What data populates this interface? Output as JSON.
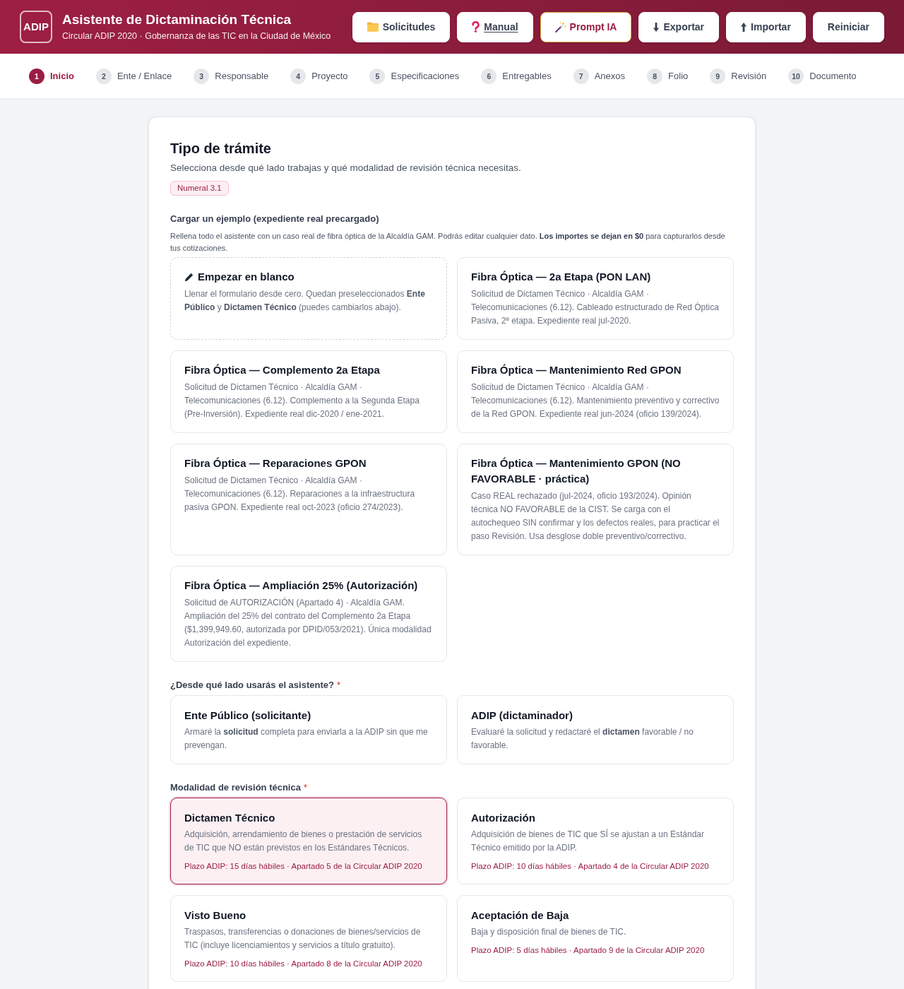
{
  "header": {
    "logo": "ADIP",
    "title": "Asistente de Dictaminación Técnica",
    "subtitle": "Circular ADIP 2020 · Gobernanza de las TIC en la Ciudad de México",
    "buttons": [
      {
        "label": "Solicitudes",
        "kind": "folder"
      },
      {
        "label": "Manual",
        "kind": "help"
      },
      {
        "label": "Prompt IA",
        "kind": "ai"
      },
      {
        "label": "Exportar",
        "kind": "export"
      },
      {
        "label": "Importar",
        "kind": "import"
      },
      {
        "label": "Reiniciar",
        "kind": "plain"
      }
    ]
  },
  "steps": [
    {
      "number": "1",
      "label": "Inicio",
      "selected": true
    },
    {
      "number": "2",
      "label": "Ente / Enlace",
      "selected": false
    },
    {
      "number": "3",
      "label": "Responsable",
      "selected": false
    },
    {
      "number": "4",
      "label": "Proyecto",
      "selected": false
    },
    {
      "number": "5",
      "label": "Especificaciones",
      "selected": false
    },
    {
      "number": "6",
      "label": "Entregables",
      "selected": false
    },
    {
      "number": "7",
      "label": "Anexos",
      "selected": false
    },
    {
      "number": "8",
      "label": "Folio",
      "selected": false
    },
    {
      "number": "9",
      "label": "Revisión",
      "selected": false
    },
    {
      "number": "10",
      "label": "Documento",
      "selected": false
    }
  ],
  "form": {
    "title": "Tipo de trámite",
    "description": "Selecciona desde qué lado trabajas y qué modalidad de revisión técnica necesitas.",
    "badge": "Numeral 3.1",
    "examples": {
      "label": "Cargar un ejemplo (expediente real precargado)",
      "description": "Rellena todo el asistente con un caso real de fibra óptica de la Alcaldía GAM. Podrás editar cualquier dato. **Los importes se dejan en $0** para capturarlos desde tus cotizaciones.",
      "cards": [
        {
          "kind": "blank",
          "title": "Empezar en blanco",
          "description": "Llenar el formulario desde cero. Quedan preseleccionados **Ente Público** y **Dictamen Técnico** (puedes cambiarlos abajo)."
        },
        {
          "kind": "example",
          "title": "Fibra Óptica — 2a Etapa (PON LAN)",
          "description": "Solicitud de Dictamen Técnico · Alcaldía GAM · Telecomunicaciones (6.12). Cableado estructurado de Red Óptica Pasiva, 2ª etapa. Expediente real jul-2020."
        },
        {
          "kind": "example",
          "title": "Fibra Óptica — Complemento 2a Etapa",
          "description": "Solicitud de Dictamen Técnico · Alcaldía GAM · Telecomunicaciones (6.12). Complemento a la Segunda Etapa (Pre-Inversión). Expediente real dic-2020 / ene-2021."
        },
        {
          "kind": "example",
          "title": "Fibra Óptica — Mantenimiento Red GPON",
          "description": "Solicitud de Dictamen Técnico · Alcaldía GAM · Telecomunicaciones (6.12). Mantenimiento preventivo y correctivo de la Red GPON. Expediente real jun-2024 (oficio 139/2024)."
        },
        {
          "kind": "example",
          "title": "Fibra Óptica — Reparaciones GPON",
          "description": "Solicitud de Dictamen Técnico · Alcaldía GAM · Telecomunicaciones (6.12). Reparaciones a la infraestructura pasiva GPON. Expediente real oct-2023 (oficio 274/2023)."
        },
        {
          "kind": "example",
          "title": "Fibra Óptica — Mantenimiento GPON (NO FAVORABLE · práctica)",
          "description": "Caso REAL rechazado (jul-2024, oficio 193/2024). Opinión técnica NO FAVORABLE de la CIST. Se carga con el autochequeo SIN confirmar y los defectos reales, para practicar el paso Revisión. Usa desglose doble preventivo/correctivo."
        },
        {
          "kind": "example",
          "title": "Fibra Óptica — Ampliación 25% (Autorización)",
          "description": "Solicitud de AUTORIZACIÓN (Apartado 4) · Alcaldía GAM. Ampliación del 25% del contrato del Complemento 2a Etapa ($1,399,949.60, autorizada por DPID/053/2021). Única modalidad Autorización del expediente."
        }
      ]
    },
    "sides": {
      "label": "¿Desde qué lado usarás el asistente?",
      "required_mark": "*",
      "options": [
        {
          "title": "Ente Público (solicitante)",
          "description": "Armaré la **solicitud** completa para enviarla a la ADIP sin que me prevengan.",
          "selected": false
        },
        {
          "title": "ADIP (dictaminador)",
          "description": "Evaluaré la solicitud y redactaré el **dictamen** favorable / no favorable.",
          "selected": false
        }
      ]
    },
    "modalities": {
      "label": "Modalidad de revisión técnica",
      "required_mark": "*",
      "options": [
        {
          "title": "Dictamen Técnico",
          "description": "Adquisición, arrendamiento de bienes o prestación de servicios de TIC que NO están previstos en los Estándares Técnicos.",
          "deadline": "Plazo ADIP: 15 días hábiles · Apartado 5 de la Circular ADIP 2020",
          "selected": true
        },
        {
          "title": "Autorización",
          "description": "Adquisición de bienes de TIC que SÍ se ajustan a un Estándar Técnico emitido por la ADIP.",
          "deadline": "Plazo ADIP: 10 días hábiles · Apartado 4 de la Circular ADIP 2020",
          "selected": false
        },
        {
          "title": "Visto Bueno",
          "description": "Traspasos, transferencias o donaciones de bienes/servicios de TIC (incluye licenciamientos y servicios a título gratuito).",
          "deadline": "Plazo ADIP: 10 días hábiles · Apartado 8 de la Circular ADIP 2020",
          "selected": false
        },
        {
          "title": "Aceptación de Baja",
          "description": "Baja y disposición final de bienes de TIC.",
          "deadline": "Plazo ADIP: 5 días hábiles · Apartado 9 de la Circular ADIP 2020",
          "selected": false
        }
      ]
    }
  }
}
